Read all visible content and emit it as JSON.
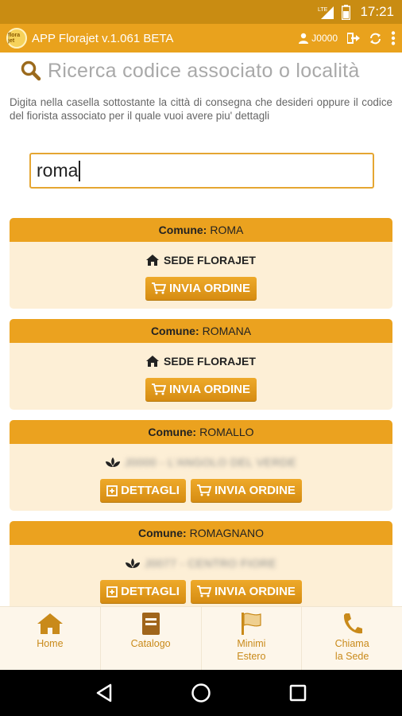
{
  "status_bar": {
    "time": "17:21",
    "network_label": "LTE"
  },
  "app_bar": {
    "title": "APP Florajet v.1.061 BETA",
    "user_code": "J0000",
    "logo_text": "flora jet",
    "icons": [
      "user-icon",
      "logout-icon",
      "refresh-icon",
      "overflow-menu-icon"
    ]
  },
  "search": {
    "title": "Ricerca codice associato o località",
    "instructions": "Digita nella casella sottostante la città di consegna che desideri oppure il codice del fiorista associato per il quale vuoi avere piu' dettagli",
    "value": "roma"
  },
  "results": [
    {
      "label": "Comune:",
      "comune": "ROMA",
      "line_type": "sede",
      "line_text": "SEDE FLORAJET",
      "buttons": [
        "INVIA ORDINE"
      ]
    },
    {
      "label": "Comune:",
      "comune": "ROMANA",
      "line_type": "sede",
      "line_text": "SEDE FLORAJET",
      "buttons": [
        "INVIA ORDINE"
      ]
    },
    {
      "label": "Comune:",
      "comune": "ROMALLO",
      "line_type": "florist",
      "line_text": "J0000 - L'ANGOLO DEL VERDE",
      "buttons": [
        "DETTAGLI",
        "INVIA ORDINE"
      ]
    },
    {
      "label": "Comune:",
      "comune": "ROMAGNANO",
      "line_type": "florist",
      "line_text": "J0077 - CENTRO FIORE",
      "buttons": [
        "DETTAGLI",
        "INVIA ORDINE"
      ]
    }
  ],
  "bottom_nav": [
    {
      "icon": "home-icon",
      "label_line1": "Home",
      "label_line2": ""
    },
    {
      "icon": "book-icon",
      "label_line1": "Catalogo",
      "label_line2": ""
    },
    {
      "icon": "flag-icon",
      "label_line1": "Minimi",
      "label_line2": "Estero"
    },
    {
      "icon": "phone-icon",
      "label_line1": "Chiama",
      "label_line2": "la Sede"
    }
  ],
  "colors": {
    "status_bar": "#c98c12",
    "app_bar": "#e9a21d",
    "card_header": "#eba21f",
    "card_body": "#fdefd6",
    "accent": "#c98a1a"
  }
}
